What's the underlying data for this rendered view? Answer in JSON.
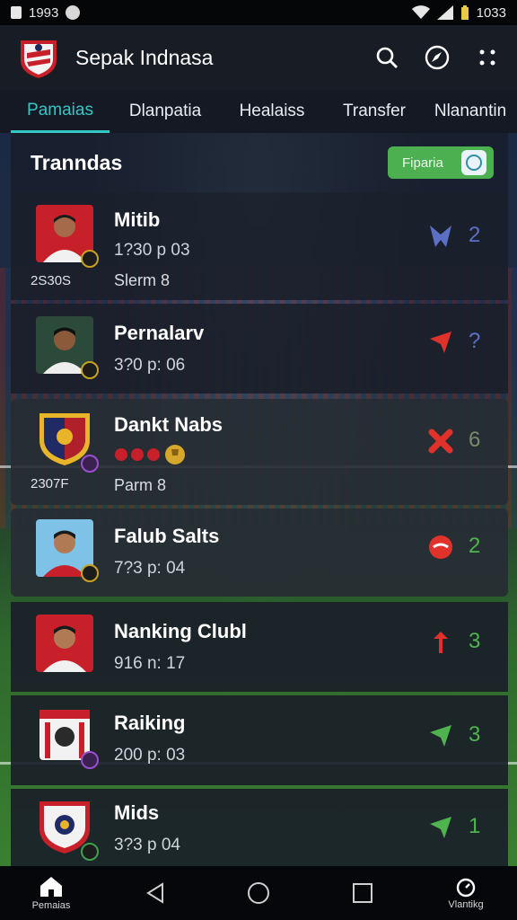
{
  "status_bar": {
    "time": "1993",
    "clock_right": "1033"
  },
  "app": {
    "title": "Sepak Indnasa"
  },
  "tabs": [
    {
      "label": "Pamaias",
      "active": true
    },
    {
      "label": "Dlanpatia",
      "active": false
    },
    {
      "label": "Healaiss",
      "active": false
    },
    {
      "label": "Transfer",
      "active": false
    },
    {
      "label": "Nlanantin",
      "active": false
    }
  ],
  "section": {
    "title": "Tranndas",
    "filter_label": "Fiparia"
  },
  "items": [
    {
      "name": "Mitib",
      "detail": "1?30 p 03",
      "extra": "Slerm 8",
      "sub_number": "2S30S",
      "trend_value": "2",
      "trend_color": "#5b6fc4",
      "trend_icon": "down-arrow-icon"
    },
    {
      "name": "Pernalarv",
      "detail": "3?0 p: 06",
      "extra": "",
      "sub_number": "",
      "trend_value": "?",
      "trend_color": "#5b6fc4",
      "trend_icon": "red-up-arrow-icon"
    },
    {
      "name": "Dankt Nabs",
      "detail": "",
      "extra": "Parm 8",
      "sub_number": "2307F",
      "trend_value": "6",
      "trend_color": "#7a8a6e",
      "trend_icon": "red-cross-icon"
    },
    {
      "name": "Falub Salts",
      "detail": "7?3 p: 04",
      "extra": "",
      "sub_number": "",
      "trend_value": "2",
      "trend_color": "#4fb34f",
      "trend_icon": "red-ball-icon"
    },
    {
      "name": "Nanking Clubl",
      "detail": "916 n: 17",
      "extra": "",
      "sub_number": "",
      "trend_value": "3",
      "trend_color": "#4fb34f",
      "trend_icon": "red-flag-icon"
    },
    {
      "name": "Raiking",
      "detail": "200 p: 03",
      "extra": "",
      "sub_number": "",
      "trend_value": "3",
      "trend_color": "#4fb34f",
      "trend_icon": "green-up-arrow-icon"
    },
    {
      "name": "Mids",
      "detail": "3?3 p 04",
      "extra": "",
      "sub_number": "",
      "trend_value": "1",
      "trend_color": "#4fb34f",
      "trend_icon": "green-up-arrow-icon"
    }
  ],
  "nav": {
    "home_label": "Pemaias",
    "right_label": "Vlantikg"
  }
}
